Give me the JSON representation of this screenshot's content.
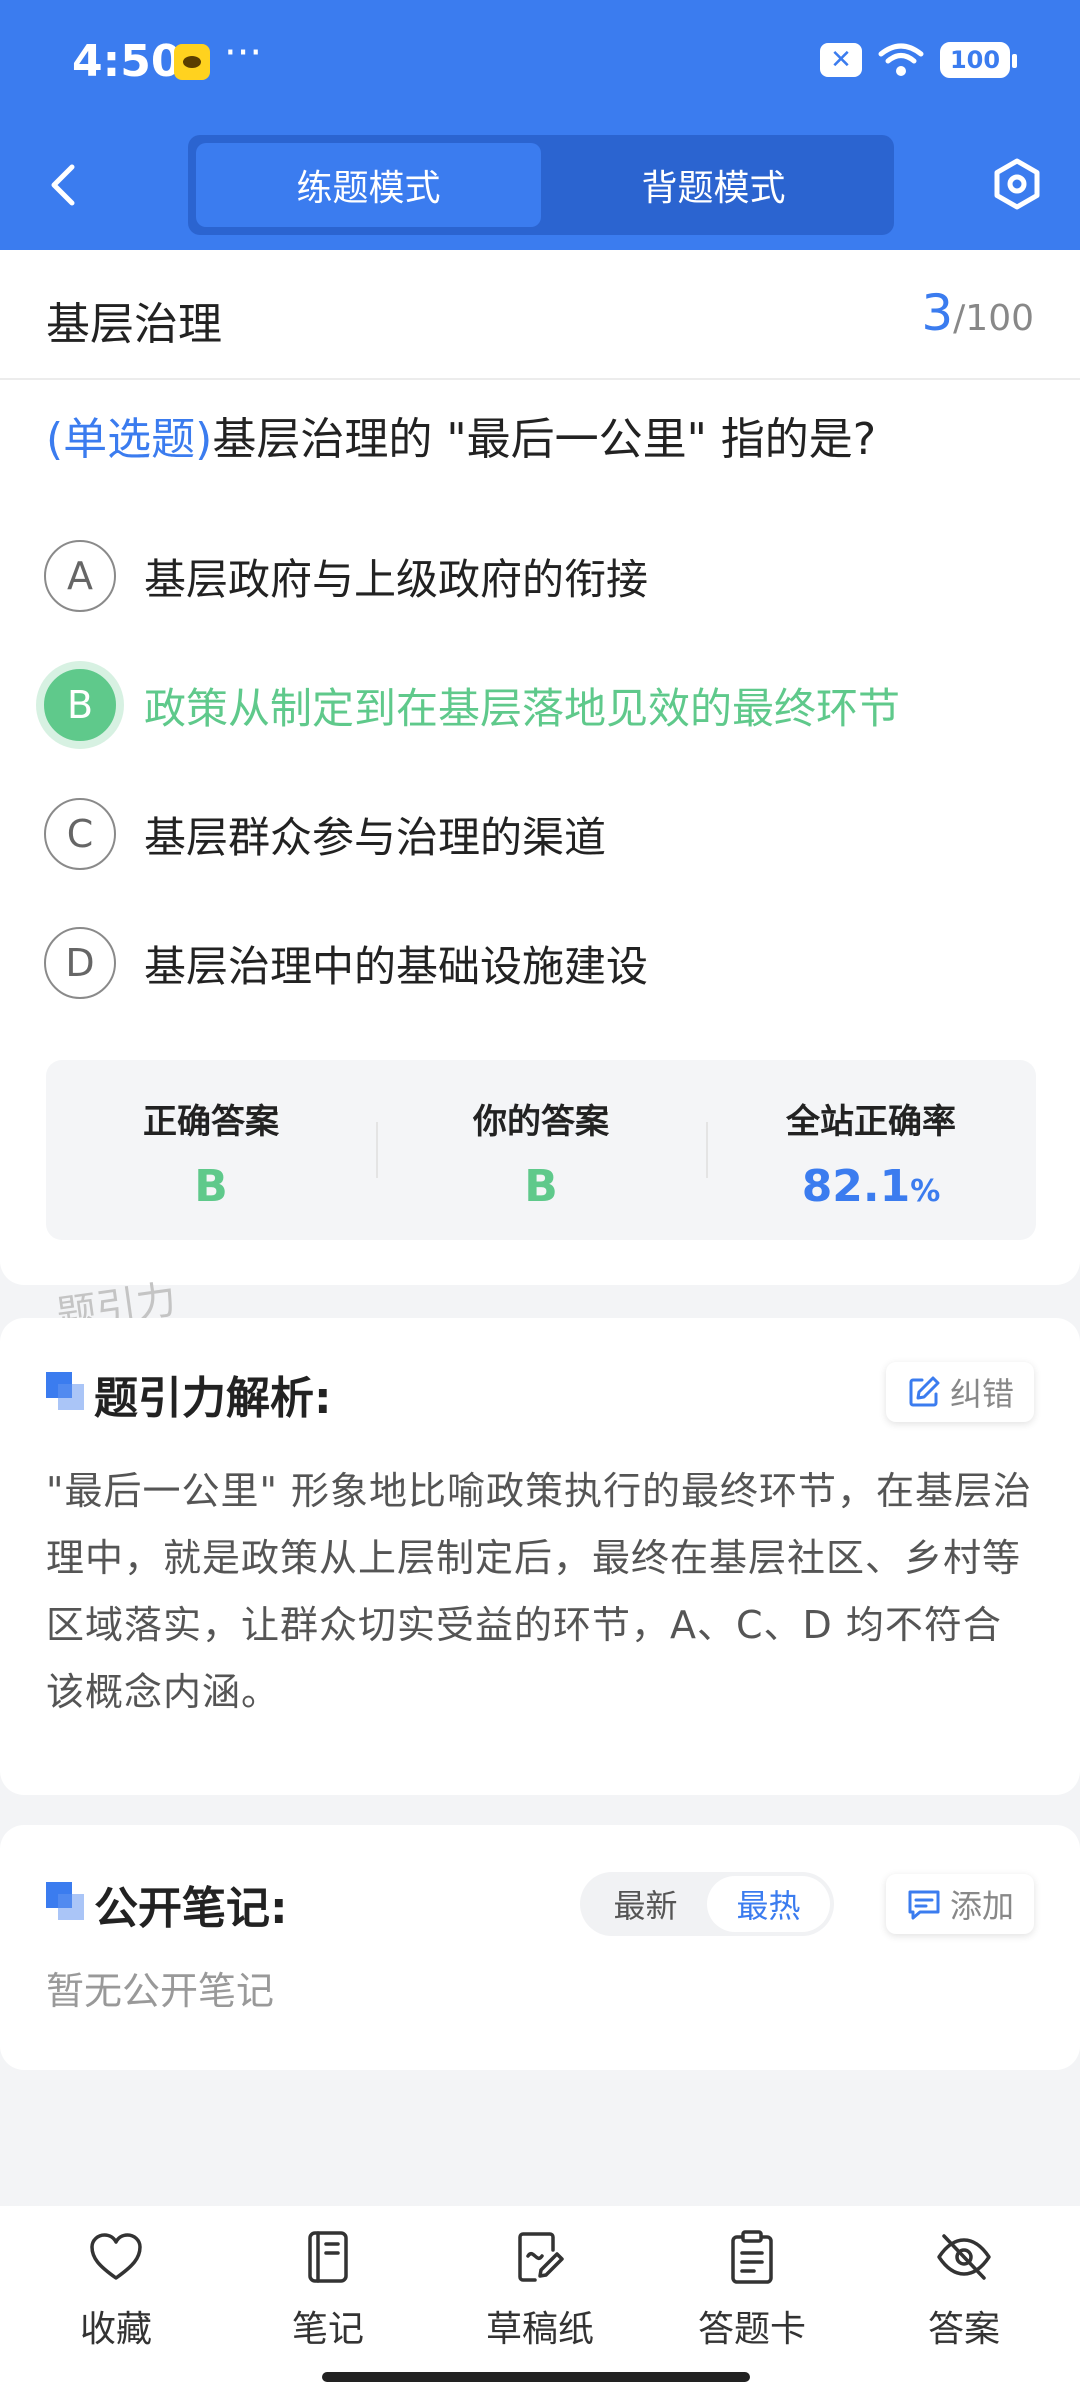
{
  "status_bar": {
    "time": "4:50",
    "dots": "···",
    "battery": "100"
  },
  "header": {
    "tabs": [
      {
        "label": "练题模式",
        "active": true
      },
      {
        "label": "背题模式",
        "active": false
      }
    ]
  },
  "question": {
    "subject": "基层治理",
    "current": "3",
    "total": "/100",
    "type": "(单选题)",
    "text": "基层治理的 \"最后一公里\" 指的是?",
    "options": [
      {
        "letter": "A",
        "text": "基层政府与上级政府的衔接"
      },
      {
        "letter": "B",
        "text": "政策从制定到在基层落地见效的最终环节",
        "correct": true
      },
      {
        "letter": "C",
        "text": "基层群众参与治理的渠道"
      },
      {
        "letter": "D",
        "text": "基层治理中的基础设施建设"
      }
    ],
    "stats": {
      "correct_label": "正确答案",
      "correct_value": "B",
      "yours_label": "你的答案",
      "yours_value": "B",
      "rate_label": "全站正确率",
      "rate_value": "82.1",
      "rate_unit": "%"
    }
  },
  "watermark": "题引力",
  "analysis": {
    "title": "题引力解析:",
    "report_label": "纠错",
    "text": "\"最后一公里\" 形象地比喻政策执行的最终环节，在基层治理中，就是政策从上层制定后，最终在基层社区、乡村等区域落实，让群众切实受益的环节，A、C、D 均不符合该概念内涵。"
  },
  "notes": {
    "title": "公开笔记:",
    "sort_newest": "最新",
    "sort_hottest": "最热",
    "add_label": "添加",
    "empty": "暂无公开笔记"
  },
  "bottom_nav": [
    {
      "label": "收藏",
      "icon": "heart-icon"
    },
    {
      "label": "笔记",
      "icon": "notebook-icon"
    },
    {
      "label": "草稿纸",
      "icon": "draft-icon"
    },
    {
      "label": "答题卡",
      "icon": "answer-card-icon"
    },
    {
      "label": "答案",
      "icon": "eye-off-icon"
    }
  ],
  "colors": {
    "primary": "#3b7cef",
    "correct": "#5fc98b"
  }
}
